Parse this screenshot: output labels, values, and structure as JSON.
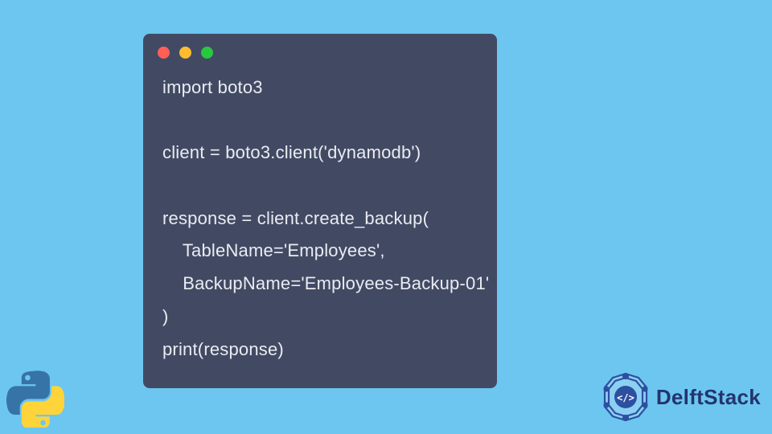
{
  "code": {
    "lines": [
      "import boto3",
      "",
      "client = boto3.client('dynamodb')",
      "",
      "response = client.create_backup(",
      "    TableName='Employees',",
      "    BackupName='Employees-Backup-01'",
      ")",
      "print(response)"
    ]
  },
  "brand": {
    "name": "DelftStack"
  },
  "colors": {
    "background": "#6CC6F0",
    "window": "#424A63",
    "text": "#EAECF2",
    "brand": "#23346E"
  }
}
